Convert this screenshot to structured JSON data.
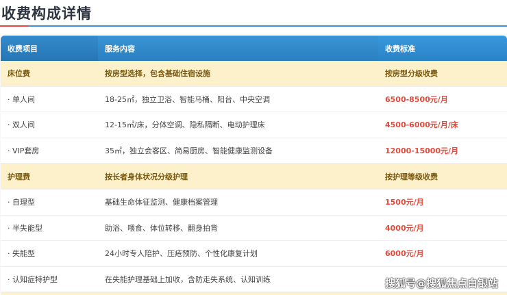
{
  "title": "收费构成详情",
  "headers": [
    "收费项目",
    "服务内容",
    "收费标准"
  ],
  "rows": [
    {
      "type": "category",
      "item": "床位费",
      "content": "按房型选择，包含基础住宿设施",
      "price": "按房型分级收费"
    },
    {
      "type": "item",
      "item": "· 单人间",
      "content": "18-25㎡，独立卫浴、智能马桶、阳台、中央空调",
      "price": "6500-8500元/月"
    },
    {
      "type": "item",
      "item": "· 双人间",
      "content": "12-15㎡/床，分体空调、隐私隔断、电动护理床",
      "price": "4500-6000元/月/床"
    },
    {
      "type": "item",
      "item": "· VIP套房",
      "content": "35㎡，独立会客区、简易厨房、智能健康监测设备",
      "price": "12000-15000元/月"
    },
    {
      "type": "category",
      "item": "护理费",
      "content": "按长者身体状况分级护理",
      "price": "按护理等级收费"
    },
    {
      "type": "item",
      "item": "· 自理型",
      "content": "基础生命体征监测、健康档案管理",
      "price": "1500元/月"
    },
    {
      "type": "item",
      "item": "· 半失能型",
      "content": "助浴、喂食、体位转移、翻身拍背",
      "price": "4000元/月"
    },
    {
      "type": "item",
      "item": "· 失能型",
      "content": "24小时专人陪护、压疮预防、个性化康复计划",
      "price": "6000元/月"
    },
    {
      "type": "item",
      "item": "· 认知症特护型",
      "content": "在失能护理基础上加收，含防走失系统、认知训练",
      "price": ""
    }
  ],
  "watermark": "搜狐号@搜狐焦点白银站"
}
